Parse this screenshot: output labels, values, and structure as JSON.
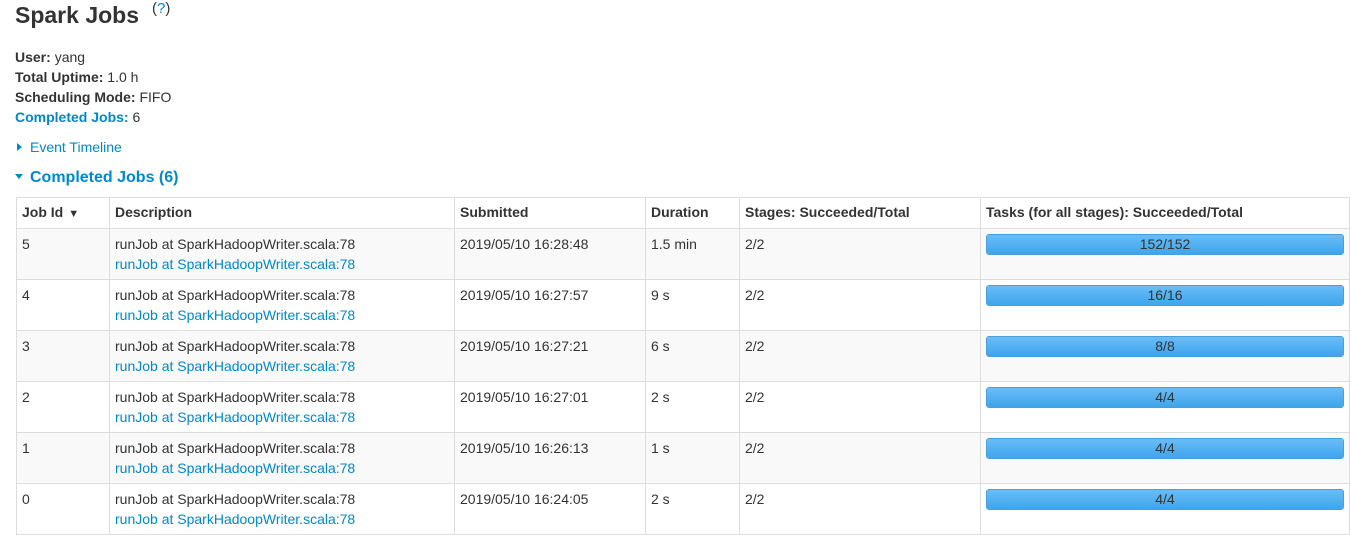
{
  "page": {
    "title": "Spark Jobs",
    "help_open": "(",
    "help_q": "?",
    "help_close": ")"
  },
  "summary": {
    "user_label": "User:",
    "user_value": "yang",
    "uptime_label": "Total Uptime:",
    "uptime_value": "1.0 h",
    "sched_label": "Scheduling Mode:",
    "sched_value": "FIFO",
    "completed_label": "Completed Jobs:",
    "completed_value": "6"
  },
  "event_timeline": "Event Timeline",
  "section_title": "Completed Jobs (6)",
  "colors": {
    "link": "#0088cc",
    "progress": "#3ea5ec"
  },
  "table": {
    "headers": [
      "Job Id",
      "Description",
      "Submitted",
      "Duration",
      "Stages: Succeeded/Total",
      "Tasks (for all stages): Succeeded/Total"
    ],
    "sort_indicator": "▼",
    "rows": [
      {
        "id": "5",
        "desc": "runJob at SparkHadoopWriter.scala:78",
        "link": "runJob at SparkHadoopWriter.scala:78",
        "submitted": "2019/05/10 16:28:48",
        "duration": "1.5 min",
        "stages": "2/2",
        "tasks": "152/152",
        "progress": 1.0
      },
      {
        "id": "4",
        "desc": "runJob at SparkHadoopWriter.scala:78",
        "link": "runJob at SparkHadoopWriter.scala:78",
        "submitted": "2019/05/10 16:27:57",
        "duration": "9 s",
        "stages": "2/2",
        "tasks": "16/16",
        "progress": 1.0
      },
      {
        "id": "3",
        "desc": "runJob at SparkHadoopWriter.scala:78",
        "link": "runJob at SparkHadoopWriter.scala:78",
        "submitted": "2019/05/10 16:27:21",
        "duration": "6 s",
        "stages": "2/2",
        "tasks": "8/8",
        "progress": 1.0
      },
      {
        "id": "2",
        "desc": "runJob at SparkHadoopWriter.scala:78",
        "link": "runJob at SparkHadoopWriter.scala:78",
        "submitted": "2019/05/10 16:27:01",
        "duration": "2 s",
        "stages": "2/2",
        "tasks": "4/4",
        "progress": 1.0
      },
      {
        "id": "1",
        "desc": "runJob at SparkHadoopWriter.scala:78",
        "link": "runJob at SparkHadoopWriter.scala:78",
        "submitted": "2019/05/10 16:26:13",
        "duration": "1 s",
        "stages": "2/2",
        "tasks": "4/4",
        "progress": 1.0
      },
      {
        "id": "0",
        "desc": "runJob at SparkHadoopWriter.scala:78",
        "link": "runJob at SparkHadoopWriter.scala:78",
        "submitted": "2019/05/10 16:24:05",
        "duration": "2 s",
        "stages": "2/2",
        "tasks": "4/4",
        "progress": 1.0
      }
    ]
  }
}
